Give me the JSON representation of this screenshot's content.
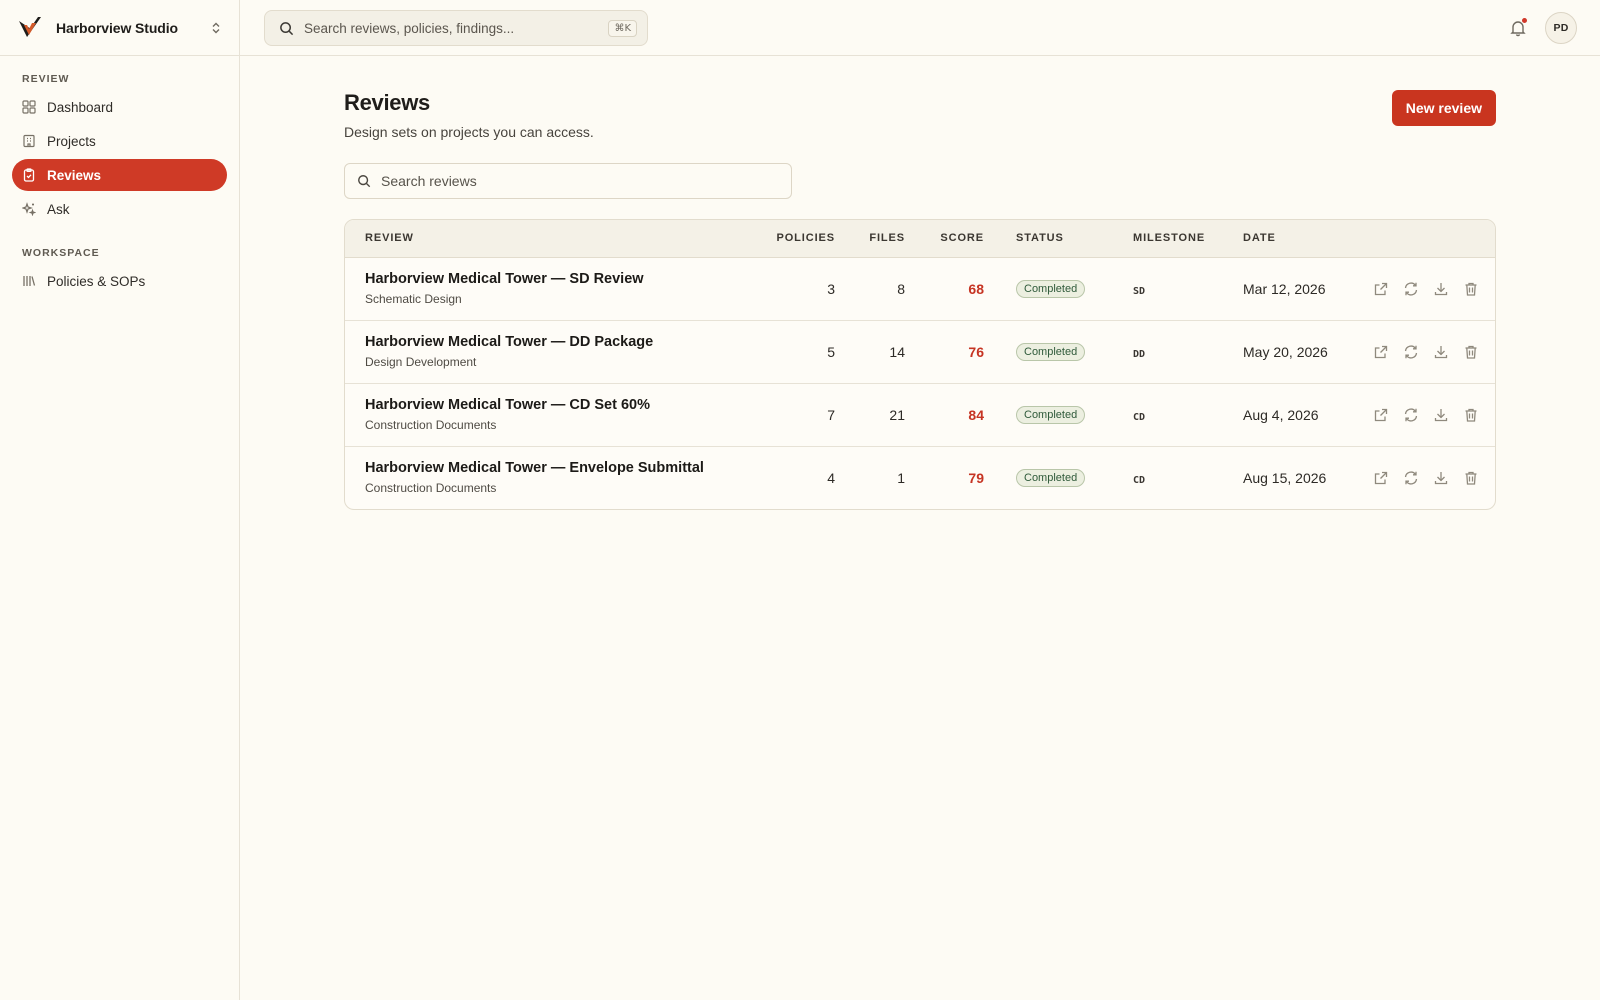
{
  "org": {
    "name": "Harborview Studio"
  },
  "search": {
    "placeholder": "Search reviews, policies, findings...",
    "shortcut": "⌘K"
  },
  "user": {
    "initials": "PD"
  },
  "sidebar": {
    "sections": [
      {
        "label": "REVIEW",
        "items": [
          {
            "label": "Dashboard",
            "icon": "dashboard-icon",
            "active": false
          },
          {
            "label": "Projects",
            "icon": "building-icon",
            "active": false
          },
          {
            "label": "Reviews",
            "icon": "clipboard-icon",
            "active": true
          },
          {
            "label": "Ask",
            "icon": "sparkle-icon",
            "active": false
          }
        ]
      },
      {
        "label": "WORKSPACE",
        "items": [
          {
            "label": "Policies & SOPs",
            "icon": "library-icon",
            "active": false
          }
        ]
      }
    ]
  },
  "page": {
    "title": "Reviews",
    "subtitle": "Design sets on projects you can access.",
    "new_button": "New review",
    "search_placeholder": "Search reviews"
  },
  "table": {
    "columns": [
      "REVIEW",
      "POLICIES",
      "FILES",
      "SCORE",
      "STATUS",
      "MILESTONE",
      "DATE"
    ],
    "rows": [
      {
        "title": "Harborview Medical Tower — SD Review",
        "phase": "Schematic Design",
        "policies": "3",
        "files": "8",
        "score": "68",
        "status": "Completed",
        "milestone": "SD",
        "date": "Mar 12, 2026"
      },
      {
        "title": "Harborview Medical Tower — DD Package",
        "phase": "Design Development",
        "policies": "5",
        "files": "14",
        "score": "76",
        "status": "Completed",
        "milestone": "DD",
        "date": "May 20, 2026"
      },
      {
        "title": "Harborview Medical Tower — CD Set 60%",
        "phase": "Construction Documents",
        "policies": "7",
        "files": "21",
        "score": "84",
        "status": "Completed",
        "milestone": "CD",
        "date": "Aug 4, 2026"
      },
      {
        "title": "Harborview Medical Tower — Envelope Submittal",
        "phase": "Construction Documents",
        "policies": "4",
        "files": "1",
        "score": "79",
        "status": "Completed",
        "milestone": "CD",
        "date": "Aug 15, 2026"
      }
    ]
  },
  "colors": {
    "accent": "#cf3a26",
    "background": "#fdfbf4",
    "status_completed": "#2f5a3a"
  }
}
